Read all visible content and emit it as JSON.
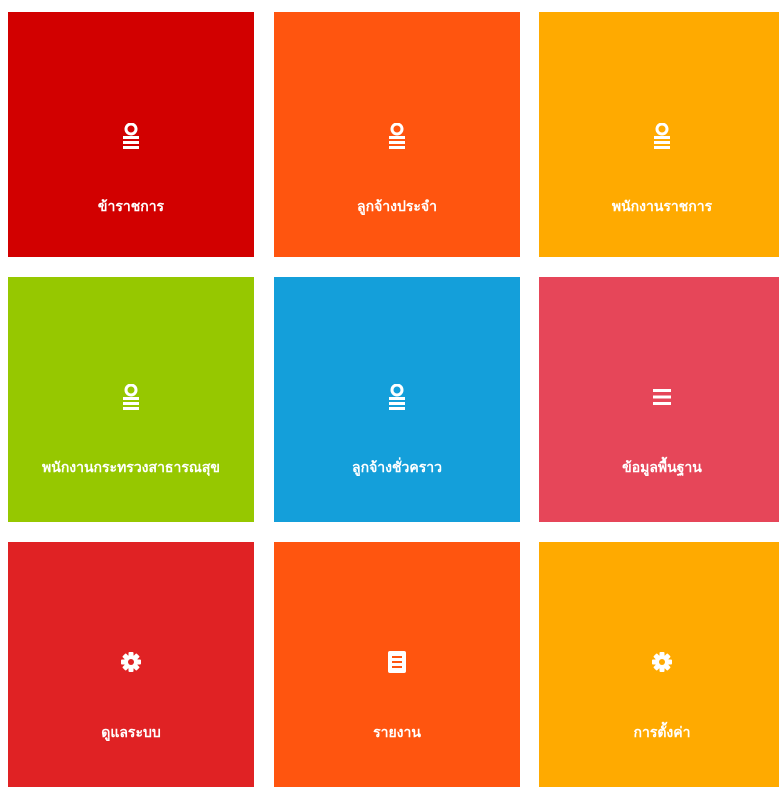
{
  "tiles": [
    {
      "label": "ข้าราชการ",
      "icon": "user-list-icon",
      "color": "#d20000"
    },
    {
      "label": "ลูกจ้างประจำ",
      "icon": "user-list-icon",
      "color": "#ff550f"
    },
    {
      "label": "พนักงานราชการ",
      "icon": "user-list-icon",
      "color": "#ffaa00"
    },
    {
      "label": "พนักงานกระทรวงสาธารณสุข",
      "icon": "user-list-icon",
      "color": "#96c800"
    },
    {
      "label": "ลูกจ้างชั่วคราว",
      "icon": "user-list-icon",
      "color": "#149fda"
    },
    {
      "label": "ข้อมูลพื้นฐาน",
      "icon": "list-icon",
      "color": "#e64659"
    },
    {
      "label": "ดูแลระบบ",
      "icon": "gear-icon",
      "color": "#e02224"
    },
    {
      "label": "รายงาน",
      "icon": "document-icon",
      "color": "#ff550f"
    },
    {
      "label": "การตั้งค่า",
      "icon": "gear-icon",
      "color": "#ffaa00"
    }
  ]
}
